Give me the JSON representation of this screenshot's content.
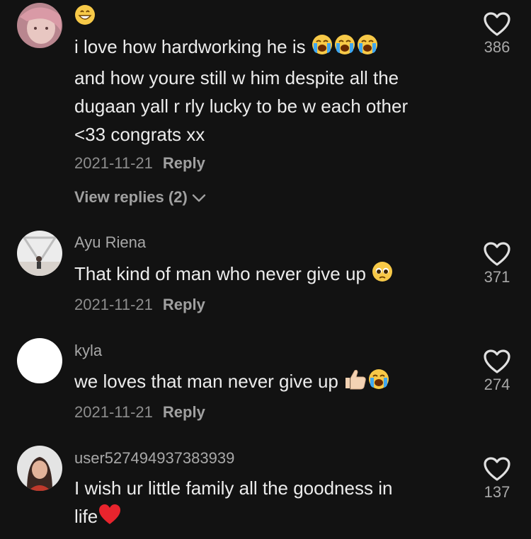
{
  "comments": [
    {
      "username": "",
      "text_lines": [
        "i love how hardworking he is",
        "and how youre still w him despite all the",
        "dugaan yall r rly lucky to be w each other",
        "<33 congrats xx"
      ],
      "date": "2021-11-21",
      "reply_label": "Reply",
      "likes": "386",
      "view_replies": "View replies (2)"
    },
    {
      "username": "Ayu Riena",
      "text": "That kind of man who never give up",
      "date": "2021-11-21",
      "reply_label": "Reply",
      "likes": "371"
    },
    {
      "username": "kyla",
      "text": "we loves that man never give up",
      "date": "2021-11-21",
      "reply_label": "Reply",
      "likes": "274"
    },
    {
      "username": "user527494937383939",
      "text_lines": [
        "I wish ur little family all the goodness in",
        "life"
      ],
      "likes": "137"
    }
  ],
  "icons": {
    "like": "heart-outline-icon",
    "expand": "chevron-down-icon"
  },
  "colors": {
    "background": "#121212",
    "text": "#ececec",
    "muted": "#8d8d8d",
    "heart": "#e0e0e0"
  }
}
